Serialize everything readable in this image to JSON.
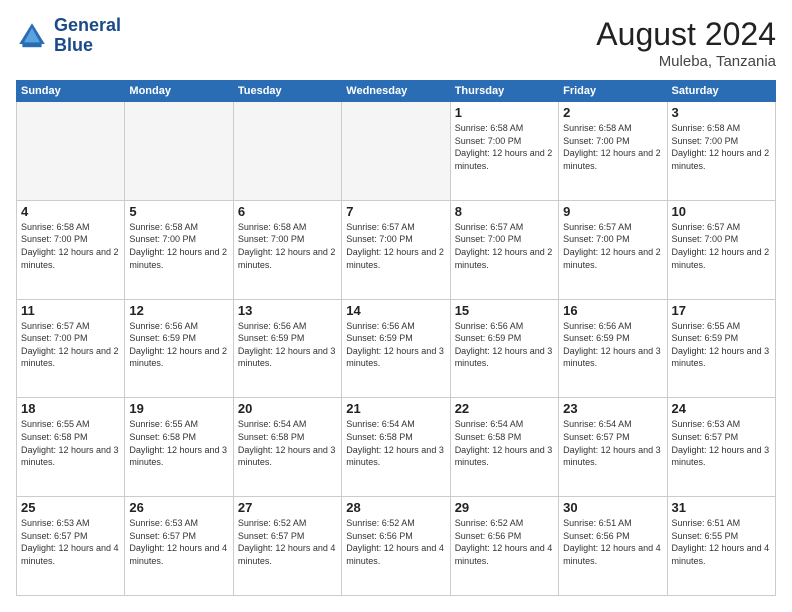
{
  "logo": {
    "line1": "General",
    "line2": "Blue"
  },
  "title": {
    "month_year": "August 2024",
    "location": "Muleba, Tanzania"
  },
  "header_days": [
    "Sunday",
    "Monday",
    "Tuesday",
    "Wednesday",
    "Thursday",
    "Friday",
    "Saturday"
  ],
  "weeks": [
    [
      {
        "day": "",
        "empty": true
      },
      {
        "day": "",
        "empty": true
      },
      {
        "day": "",
        "empty": true
      },
      {
        "day": "",
        "empty": true
      },
      {
        "day": "1",
        "sunrise": "6:58 AM",
        "sunset": "7:00 PM",
        "daylight": "12 hours and 2 minutes."
      },
      {
        "day": "2",
        "sunrise": "6:58 AM",
        "sunset": "7:00 PM",
        "daylight": "12 hours and 2 minutes."
      },
      {
        "day": "3",
        "sunrise": "6:58 AM",
        "sunset": "7:00 PM",
        "daylight": "12 hours and 2 minutes."
      }
    ],
    [
      {
        "day": "4",
        "sunrise": "6:58 AM",
        "sunset": "7:00 PM",
        "daylight": "12 hours and 2 minutes."
      },
      {
        "day": "5",
        "sunrise": "6:58 AM",
        "sunset": "7:00 PM",
        "daylight": "12 hours and 2 minutes."
      },
      {
        "day": "6",
        "sunrise": "6:58 AM",
        "sunset": "7:00 PM",
        "daylight": "12 hours and 2 minutes."
      },
      {
        "day": "7",
        "sunrise": "6:57 AM",
        "sunset": "7:00 PM",
        "daylight": "12 hours and 2 minutes."
      },
      {
        "day": "8",
        "sunrise": "6:57 AM",
        "sunset": "7:00 PM",
        "daylight": "12 hours and 2 minutes."
      },
      {
        "day": "9",
        "sunrise": "6:57 AM",
        "sunset": "7:00 PM",
        "daylight": "12 hours and 2 minutes."
      },
      {
        "day": "10",
        "sunrise": "6:57 AM",
        "sunset": "7:00 PM",
        "daylight": "12 hours and 2 minutes."
      }
    ],
    [
      {
        "day": "11",
        "sunrise": "6:57 AM",
        "sunset": "7:00 PM",
        "daylight": "12 hours and 2 minutes."
      },
      {
        "day": "12",
        "sunrise": "6:56 AM",
        "sunset": "6:59 PM",
        "daylight": "12 hours and 2 minutes."
      },
      {
        "day": "13",
        "sunrise": "6:56 AM",
        "sunset": "6:59 PM",
        "daylight": "12 hours and 3 minutes."
      },
      {
        "day": "14",
        "sunrise": "6:56 AM",
        "sunset": "6:59 PM",
        "daylight": "12 hours and 3 minutes."
      },
      {
        "day": "15",
        "sunrise": "6:56 AM",
        "sunset": "6:59 PM",
        "daylight": "12 hours and 3 minutes."
      },
      {
        "day": "16",
        "sunrise": "6:56 AM",
        "sunset": "6:59 PM",
        "daylight": "12 hours and 3 minutes."
      },
      {
        "day": "17",
        "sunrise": "6:55 AM",
        "sunset": "6:59 PM",
        "daylight": "12 hours and 3 minutes."
      }
    ],
    [
      {
        "day": "18",
        "sunrise": "6:55 AM",
        "sunset": "6:58 PM",
        "daylight": "12 hours and 3 minutes."
      },
      {
        "day": "19",
        "sunrise": "6:55 AM",
        "sunset": "6:58 PM",
        "daylight": "12 hours and 3 minutes."
      },
      {
        "day": "20",
        "sunrise": "6:54 AM",
        "sunset": "6:58 PM",
        "daylight": "12 hours and 3 minutes."
      },
      {
        "day": "21",
        "sunrise": "6:54 AM",
        "sunset": "6:58 PM",
        "daylight": "12 hours and 3 minutes."
      },
      {
        "day": "22",
        "sunrise": "6:54 AM",
        "sunset": "6:58 PM",
        "daylight": "12 hours and 3 minutes."
      },
      {
        "day": "23",
        "sunrise": "6:54 AM",
        "sunset": "6:57 PM",
        "daylight": "12 hours and 3 minutes."
      },
      {
        "day": "24",
        "sunrise": "6:53 AM",
        "sunset": "6:57 PM",
        "daylight": "12 hours and 3 minutes."
      }
    ],
    [
      {
        "day": "25",
        "sunrise": "6:53 AM",
        "sunset": "6:57 PM",
        "daylight": "12 hours and 4 minutes."
      },
      {
        "day": "26",
        "sunrise": "6:53 AM",
        "sunset": "6:57 PM",
        "daylight": "12 hours and 4 minutes."
      },
      {
        "day": "27",
        "sunrise": "6:52 AM",
        "sunset": "6:57 PM",
        "daylight": "12 hours and 4 minutes."
      },
      {
        "day": "28",
        "sunrise": "6:52 AM",
        "sunset": "6:56 PM",
        "daylight": "12 hours and 4 minutes."
      },
      {
        "day": "29",
        "sunrise": "6:52 AM",
        "sunset": "6:56 PM",
        "daylight": "12 hours and 4 minutes."
      },
      {
        "day": "30",
        "sunrise": "6:51 AM",
        "sunset": "6:56 PM",
        "daylight": "12 hours and 4 minutes."
      },
      {
        "day": "31",
        "sunrise": "6:51 AM",
        "sunset": "6:55 PM",
        "daylight": "12 hours and 4 minutes."
      }
    ]
  ]
}
